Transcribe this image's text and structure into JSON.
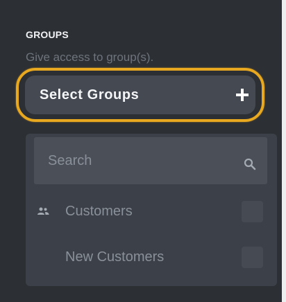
{
  "section": {
    "heading": "GROUPS",
    "subtitle": "Give access to group(s)."
  },
  "select_groups": {
    "label": "Select Groups",
    "icon": "plus-icon"
  },
  "search": {
    "placeholder": "Search",
    "icon": "search-icon"
  },
  "groups": [
    {
      "label": "Customers",
      "icon": "users-icon",
      "checked": false
    },
    {
      "label": "New Customers",
      "checked": false
    }
  ],
  "colors": {
    "background": "#2c2f34",
    "highlight": "#e8a81f",
    "button": "#444952",
    "panel": "#3c4149"
  }
}
